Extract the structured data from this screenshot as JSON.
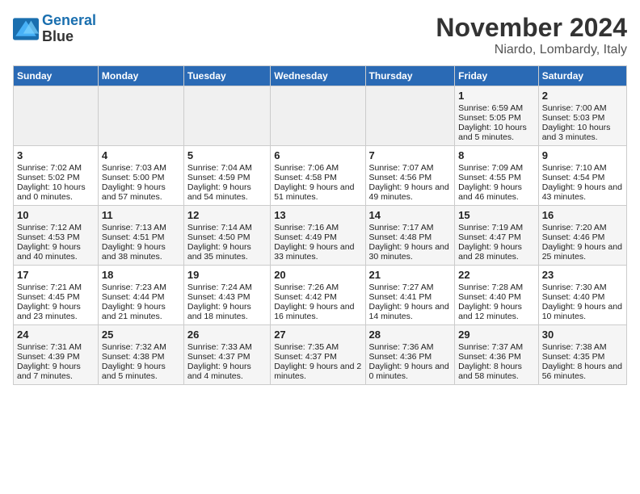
{
  "header": {
    "logo": {
      "line1": "General",
      "line2": "Blue"
    },
    "title": "November 2024",
    "location": "Niardo, Lombardy, Italy"
  },
  "weekdays": [
    "Sunday",
    "Monday",
    "Tuesday",
    "Wednesday",
    "Thursday",
    "Friday",
    "Saturday"
  ],
  "weeks": [
    [
      {
        "day": "",
        "info": ""
      },
      {
        "day": "",
        "info": ""
      },
      {
        "day": "",
        "info": ""
      },
      {
        "day": "",
        "info": ""
      },
      {
        "day": "",
        "info": ""
      },
      {
        "day": "1",
        "info": "Sunrise: 6:59 AM\nSunset: 5:05 PM\nDaylight: 10 hours and 5 minutes."
      },
      {
        "day": "2",
        "info": "Sunrise: 7:00 AM\nSunset: 5:03 PM\nDaylight: 10 hours and 3 minutes."
      }
    ],
    [
      {
        "day": "3",
        "info": "Sunrise: 7:02 AM\nSunset: 5:02 PM\nDaylight: 10 hours and 0 minutes."
      },
      {
        "day": "4",
        "info": "Sunrise: 7:03 AM\nSunset: 5:00 PM\nDaylight: 9 hours and 57 minutes."
      },
      {
        "day": "5",
        "info": "Sunrise: 7:04 AM\nSunset: 4:59 PM\nDaylight: 9 hours and 54 minutes."
      },
      {
        "day": "6",
        "info": "Sunrise: 7:06 AM\nSunset: 4:58 PM\nDaylight: 9 hours and 51 minutes."
      },
      {
        "day": "7",
        "info": "Sunrise: 7:07 AM\nSunset: 4:56 PM\nDaylight: 9 hours and 49 minutes."
      },
      {
        "day": "8",
        "info": "Sunrise: 7:09 AM\nSunset: 4:55 PM\nDaylight: 9 hours and 46 minutes."
      },
      {
        "day": "9",
        "info": "Sunrise: 7:10 AM\nSunset: 4:54 PM\nDaylight: 9 hours and 43 minutes."
      }
    ],
    [
      {
        "day": "10",
        "info": "Sunrise: 7:12 AM\nSunset: 4:53 PM\nDaylight: 9 hours and 40 minutes."
      },
      {
        "day": "11",
        "info": "Sunrise: 7:13 AM\nSunset: 4:51 PM\nDaylight: 9 hours and 38 minutes."
      },
      {
        "day": "12",
        "info": "Sunrise: 7:14 AM\nSunset: 4:50 PM\nDaylight: 9 hours and 35 minutes."
      },
      {
        "day": "13",
        "info": "Sunrise: 7:16 AM\nSunset: 4:49 PM\nDaylight: 9 hours and 33 minutes."
      },
      {
        "day": "14",
        "info": "Sunrise: 7:17 AM\nSunset: 4:48 PM\nDaylight: 9 hours and 30 minutes."
      },
      {
        "day": "15",
        "info": "Sunrise: 7:19 AM\nSunset: 4:47 PM\nDaylight: 9 hours and 28 minutes."
      },
      {
        "day": "16",
        "info": "Sunrise: 7:20 AM\nSunset: 4:46 PM\nDaylight: 9 hours and 25 minutes."
      }
    ],
    [
      {
        "day": "17",
        "info": "Sunrise: 7:21 AM\nSunset: 4:45 PM\nDaylight: 9 hours and 23 minutes."
      },
      {
        "day": "18",
        "info": "Sunrise: 7:23 AM\nSunset: 4:44 PM\nDaylight: 9 hours and 21 minutes."
      },
      {
        "day": "19",
        "info": "Sunrise: 7:24 AM\nSunset: 4:43 PM\nDaylight: 9 hours and 18 minutes."
      },
      {
        "day": "20",
        "info": "Sunrise: 7:26 AM\nSunset: 4:42 PM\nDaylight: 9 hours and 16 minutes."
      },
      {
        "day": "21",
        "info": "Sunrise: 7:27 AM\nSunset: 4:41 PM\nDaylight: 9 hours and 14 minutes."
      },
      {
        "day": "22",
        "info": "Sunrise: 7:28 AM\nSunset: 4:40 PM\nDaylight: 9 hours and 12 minutes."
      },
      {
        "day": "23",
        "info": "Sunrise: 7:30 AM\nSunset: 4:40 PM\nDaylight: 9 hours and 10 minutes."
      }
    ],
    [
      {
        "day": "24",
        "info": "Sunrise: 7:31 AM\nSunset: 4:39 PM\nDaylight: 9 hours and 7 minutes."
      },
      {
        "day": "25",
        "info": "Sunrise: 7:32 AM\nSunset: 4:38 PM\nDaylight: 9 hours and 5 minutes."
      },
      {
        "day": "26",
        "info": "Sunrise: 7:33 AM\nSunset: 4:37 PM\nDaylight: 9 hours and 4 minutes."
      },
      {
        "day": "27",
        "info": "Sunrise: 7:35 AM\nSunset: 4:37 PM\nDaylight: 9 hours and 2 minutes."
      },
      {
        "day": "28",
        "info": "Sunrise: 7:36 AM\nSunset: 4:36 PM\nDaylight: 9 hours and 0 minutes."
      },
      {
        "day": "29",
        "info": "Sunrise: 7:37 AM\nSunset: 4:36 PM\nDaylight: 8 hours and 58 minutes."
      },
      {
        "day": "30",
        "info": "Sunrise: 7:38 AM\nSunset: 4:35 PM\nDaylight: 8 hours and 56 minutes."
      }
    ]
  ]
}
